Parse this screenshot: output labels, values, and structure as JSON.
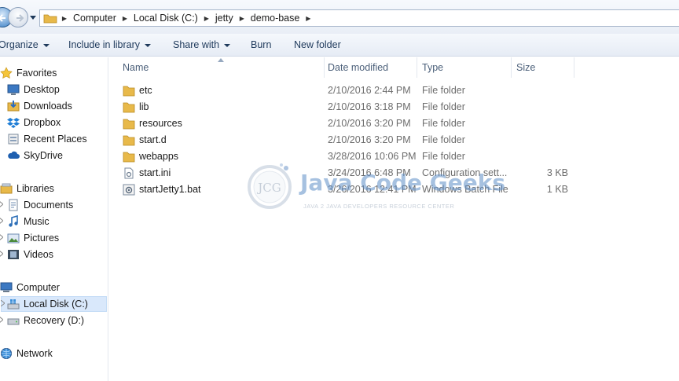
{
  "window": {
    "breadcrumb": [
      "Computer",
      "Local Disk (C:)",
      "jetty",
      "demo-base"
    ]
  },
  "toolbar": {
    "organize": "Organize",
    "include_in_library": "Include in library",
    "share_with": "Share with",
    "burn": "Burn",
    "new_folder": "New folder"
  },
  "navigation": {
    "favorites": {
      "label": "Favorites",
      "items": [
        "Desktop",
        "Downloads",
        "Dropbox",
        "Recent Places",
        "SkyDrive"
      ]
    },
    "libraries": {
      "label": "Libraries",
      "items": [
        "Documents",
        "Music",
        "Pictures",
        "Videos"
      ]
    },
    "computer": {
      "label": "Computer",
      "items": [
        "Local Disk (C:)",
        "Recovery (D:)"
      ],
      "selected": "Local Disk (C:)"
    },
    "network": {
      "label": "Network"
    }
  },
  "columns": {
    "name": "Name",
    "date_modified": "Date modified",
    "type": "Type",
    "size": "Size"
  },
  "files": [
    {
      "name": "etc",
      "date": "2/10/2016 2:44 PM",
      "type": "File folder",
      "size": "",
      "icon": "folder-icon"
    },
    {
      "name": "lib",
      "date": "2/10/2016 3:18 PM",
      "type": "File folder",
      "size": "",
      "icon": "folder-icon"
    },
    {
      "name": "resources",
      "date": "2/10/2016 3:20 PM",
      "type": "File folder",
      "size": "",
      "icon": "folder-icon"
    },
    {
      "name": "start.d",
      "date": "2/10/2016 3:20 PM",
      "type": "File folder",
      "size": "",
      "icon": "folder-icon"
    },
    {
      "name": "webapps",
      "date": "3/28/2016 10:06 PM",
      "type": "File folder",
      "size": "",
      "icon": "folder-icon"
    },
    {
      "name": "start.ini",
      "date": "3/24/2016 6:48 PM",
      "type": "Configuration sett...",
      "size": "3 KB",
      "icon": "config-file-icon"
    },
    {
      "name": "startJetty1.bat",
      "date": "3/26/2016 12:41 PM",
      "type": "Windows Batch File",
      "size": "1 KB",
      "icon": "batch-file-icon"
    }
  ],
  "watermark": {
    "logo_text": "JCG",
    "title": "Java Code Geeks",
    "subtitle": "JAVA 2 JAVA DEVELOPERS RESOURCE CENTER"
  },
  "colors": {
    "toolbar_text": "#1e395b",
    "selection": "#d9e8fb",
    "folder": "#e8b94a"
  }
}
